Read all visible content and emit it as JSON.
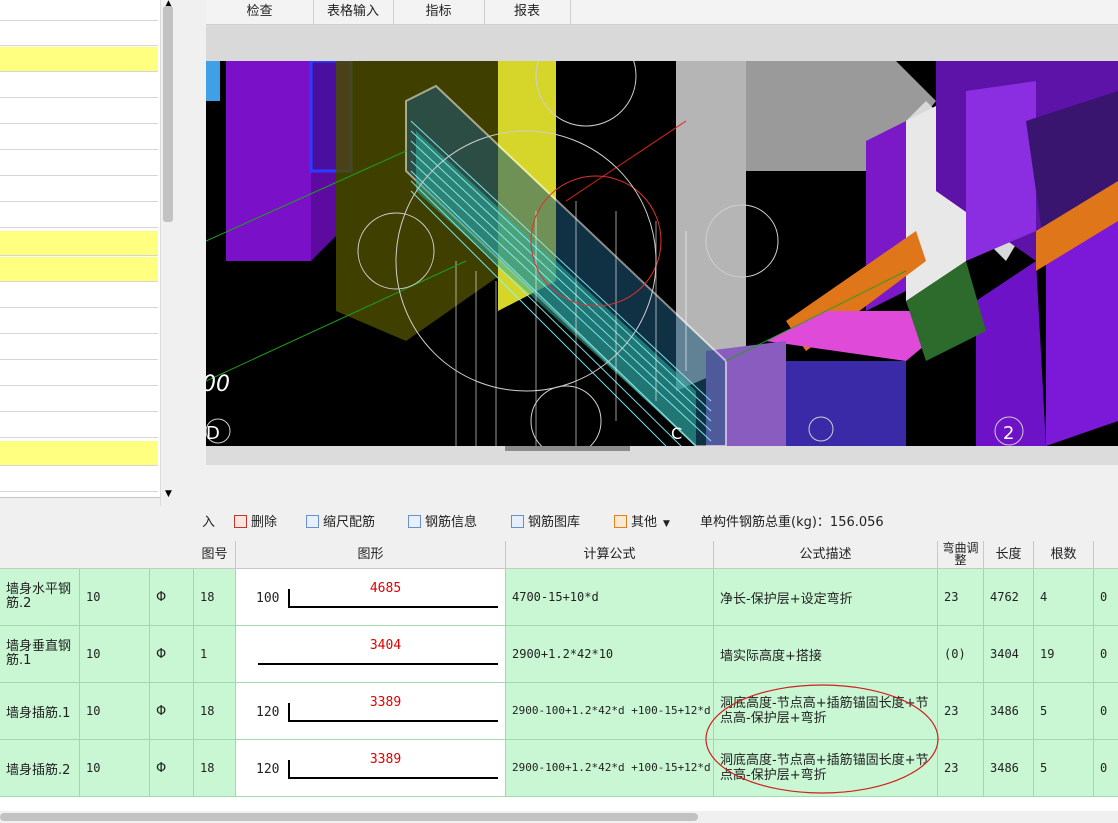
{
  "menu": {
    "items": [
      "检查",
      "表格输入",
      "指标",
      "报表"
    ]
  },
  "toolbar": {
    "insert_fragment": "入",
    "delete": "删除",
    "scale_rebar": "缩尺配筋",
    "rebar_info": "钢筋信息",
    "rebar_library": "钢筋图库",
    "other": "其他",
    "total_weight_label": "单构件钢筋总重(kg)：156.056"
  },
  "table": {
    "headers": {
      "figure_no": "图号",
      "shape": "图形",
      "formula": "计算公式",
      "description": "公式描述",
      "bend_adjust": "弯曲调整",
      "length": "长度",
      "count": "根数"
    },
    "rows": [
      {
        "name": "墙身水平钢筋.2",
        "diameter": "10",
        "grade": "Φ",
        "figure_no": "18",
        "left_len": "100",
        "main_len": "4685",
        "formula": "4700-15+10*d",
        "description": "净长-保护层+设定弯折",
        "bend": "23",
        "length": "4762",
        "count": "4",
        "extra": "0"
      },
      {
        "name": "墙身垂直钢筋.1",
        "diameter": "10",
        "grade": "Φ",
        "figure_no": "1",
        "left_len": "",
        "main_len": "3404",
        "formula": "2900+1.2*42*10",
        "description": "墙实际高度+搭接",
        "bend": "(0)",
        "length": "3404",
        "count": "19",
        "extra": "0"
      },
      {
        "name": "墙身插筋.1",
        "diameter": "10",
        "grade": "Φ",
        "figure_no": "18",
        "left_len": "120",
        "main_len": "3389",
        "formula": "2900-100+1.2*42*d +100-15+12*d",
        "description": "洞底高度-节点高+插筋锚固长度+节点高-保护层+弯折",
        "bend": "23",
        "length": "3486",
        "count": "5",
        "extra": "0"
      },
      {
        "name": "墙身插筋.2",
        "diameter": "10",
        "grade": "Φ",
        "figure_no": "18",
        "left_len": "120",
        "main_len": "3389",
        "formula": "2900-100+1.2*42*d +100-15+12*d",
        "description": "洞底高度-节点高+插筋锚固长度+节点高-保护层+弯折",
        "bend": "23",
        "length": "3486",
        "count": "5",
        "extra": "0"
      }
    ]
  },
  "view3d": {
    "axis_labels": [
      "00",
      "D",
      "C",
      "2"
    ]
  },
  "colors": {
    "row_green": "#c9f7d3",
    "list_highlight": "#ffff80",
    "annotation_red": "#e00000"
  }
}
